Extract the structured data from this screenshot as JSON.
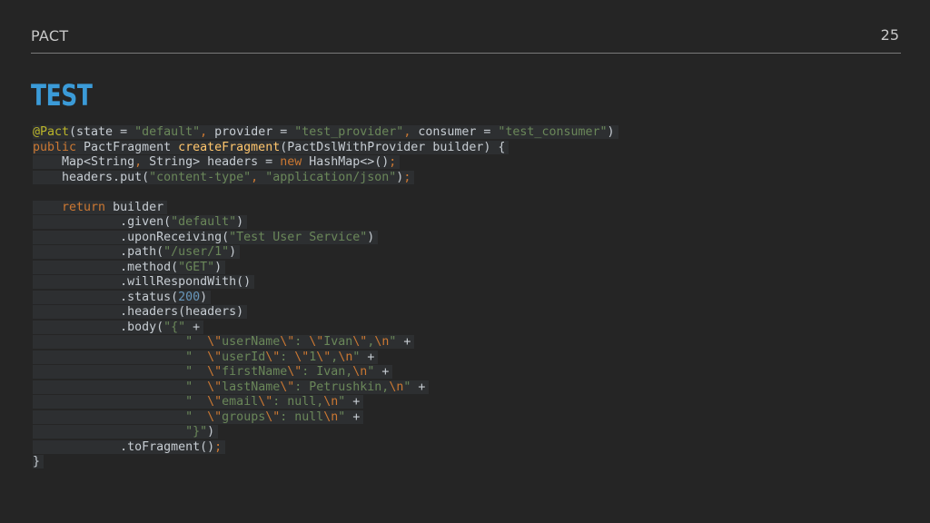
{
  "header": {
    "label": "PACT",
    "page_number": "25"
  },
  "title": "TEST",
  "code_lines": [
    [
      [
        "ann",
        "@Pact"
      ],
      [
        "p",
        "(state = "
      ],
      [
        "str",
        "\"default\""
      ],
      [
        "kw",
        ", "
      ],
      [
        "p",
        "provider = "
      ],
      [
        "str",
        "\"test_provider\""
      ],
      [
        "kw",
        ", "
      ],
      [
        "p",
        "consumer = "
      ],
      [
        "str",
        "\"test_consumer\""
      ],
      [
        "p",
        ")"
      ]
    ],
    [
      [
        "kw",
        "public "
      ],
      [
        "p",
        "PactFragment "
      ],
      [
        "fn",
        "createFragment"
      ],
      [
        "p",
        "(PactDslWithProvider builder) {"
      ]
    ],
    [
      [
        "p",
        "    Map<String"
      ],
      [
        "kw",
        ", "
      ],
      [
        "p",
        "String> headers = "
      ],
      [
        "kw",
        "new "
      ],
      [
        "p",
        "HashMap<>()"
      ],
      [
        "kw",
        ";"
      ]
    ],
    [
      [
        "p",
        "    headers.put("
      ],
      [
        "str",
        "\"content-type\""
      ],
      [
        "kw",
        ", "
      ],
      [
        "str",
        "\"application/json\""
      ],
      [
        "p",
        ")"
      ],
      [
        "kw",
        ";"
      ]
    ],
    [],
    [
      [
        "kw",
        "    return "
      ],
      [
        "p",
        "builder"
      ]
    ],
    [
      [
        "p",
        "            .given("
      ],
      [
        "str",
        "\"default\""
      ],
      [
        "p",
        ")"
      ]
    ],
    [
      [
        "p",
        "            .uponReceiving("
      ],
      [
        "str",
        "\"Test User Service\""
      ],
      [
        "p",
        ")"
      ]
    ],
    [
      [
        "p",
        "            .path("
      ],
      [
        "str",
        "\"/user/1\""
      ],
      [
        "p",
        ")"
      ]
    ],
    [
      [
        "p",
        "            .method("
      ],
      [
        "str",
        "\"GET\""
      ],
      [
        "p",
        ")"
      ]
    ],
    [
      [
        "p",
        "            .willRespondWith()"
      ]
    ],
    [
      [
        "p",
        "            .status("
      ],
      [
        "num",
        "200"
      ],
      [
        "p",
        ")"
      ]
    ],
    [
      [
        "p",
        "            .headers(headers)"
      ]
    ],
    [
      [
        "p",
        "            .body("
      ],
      [
        "str",
        "\"{\" "
      ],
      [
        "p",
        "+"
      ]
    ],
    [
      [
        "p",
        "                     "
      ],
      [
        "str",
        "\"  "
      ],
      [
        "esc",
        "\\\""
      ],
      [
        "str",
        "userName"
      ],
      [
        "esc",
        "\\\""
      ],
      [
        "str",
        ": "
      ],
      [
        "esc",
        "\\\""
      ],
      [
        "str",
        "Ivan"
      ],
      [
        "esc",
        "\\\""
      ],
      [
        "str",
        ","
      ],
      [
        "esc",
        "\\n"
      ],
      [
        "str",
        "\" "
      ],
      [
        "p",
        "+"
      ]
    ],
    [
      [
        "p",
        "                     "
      ],
      [
        "str",
        "\"  "
      ],
      [
        "esc",
        "\\\""
      ],
      [
        "str",
        "userId"
      ],
      [
        "esc",
        "\\\""
      ],
      [
        "str",
        ": "
      ],
      [
        "esc",
        "\\\""
      ],
      [
        "str",
        "1"
      ],
      [
        "esc",
        "\\\""
      ],
      [
        "str",
        ","
      ],
      [
        "esc",
        "\\n"
      ],
      [
        "str",
        "\" "
      ],
      [
        "p",
        "+"
      ]
    ],
    [
      [
        "p",
        "                     "
      ],
      [
        "str",
        "\"  "
      ],
      [
        "esc",
        "\\\""
      ],
      [
        "str",
        "firstName"
      ],
      [
        "esc",
        "\\\""
      ],
      [
        "str",
        ": Ivan,"
      ],
      [
        "esc",
        "\\n"
      ],
      [
        "str",
        "\" "
      ],
      [
        "p",
        "+"
      ]
    ],
    [
      [
        "p",
        "                     "
      ],
      [
        "str",
        "\"  "
      ],
      [
        "esc",
        "\\\""
      ],
      [
        "str",
        "lastName"
      ],
      [
        "esc",
        "\\\""
      ],
      [
        "str",
        ": Petrushkin,"
      ],
      [
        "esc",
        "\\n"
      ],
      [
        "str",
        "\" "
      ],
      [
        "p",
        "+"
      ]
    ],
    [
      [
        "p",
        "                     "
      ],
      [
        "str",
        "\"  "
      ],
      [
        "esc",
        "\\\""
      ],
      [
        "str",
        "email"
      ],
      [
        "esc",
        "\\\""
      ],
      [
        "str",
        ": null,"
      ],
      [
        "esc",
        "\\n"
      ],
      [
        "str",
        "\" "
      ],
      [
        "p",
        "+"
      ]
    ],
    [
      [
        "p",
        "                     "
      ],
      [
        "str",
        "\"  "
      ],
      [
        "esc",
        "\\\""
      ],
      [
        "str",
        "groups"
      ],
      [
        "esc",
        "\\\""
      ],
      [
        "str",
        ": null"
      ],
      [
        "esc",
        "\\n"
      ],
      [
        "str",
        "\" "
      ],
      [
        "p",
        "+"
      ]
    ],
    [
      [
        "p",
        "                     "
      ],
      [
        "str",
        "\"}\""
      ],
      [
        "p",
        ")"
      ]
    ],
    [
      [
        "p",
        "            .toFragment()"
      ],
      [
        "kw",
        ";"
      ]
    ],
    [
      [
        "p",
        "}"
      ]
    ]
  ],
  "colors": {
    "background": "#252525",
    "title": "#3b9bd8",
    "keyword": "#cc7832",
    "string": "#6a8759",
    "annotation": "#bbb529",
    "function": "#ffc66d",
    "number": "#6897bb",
    "plain": "#c7cdd3"
  }
}
